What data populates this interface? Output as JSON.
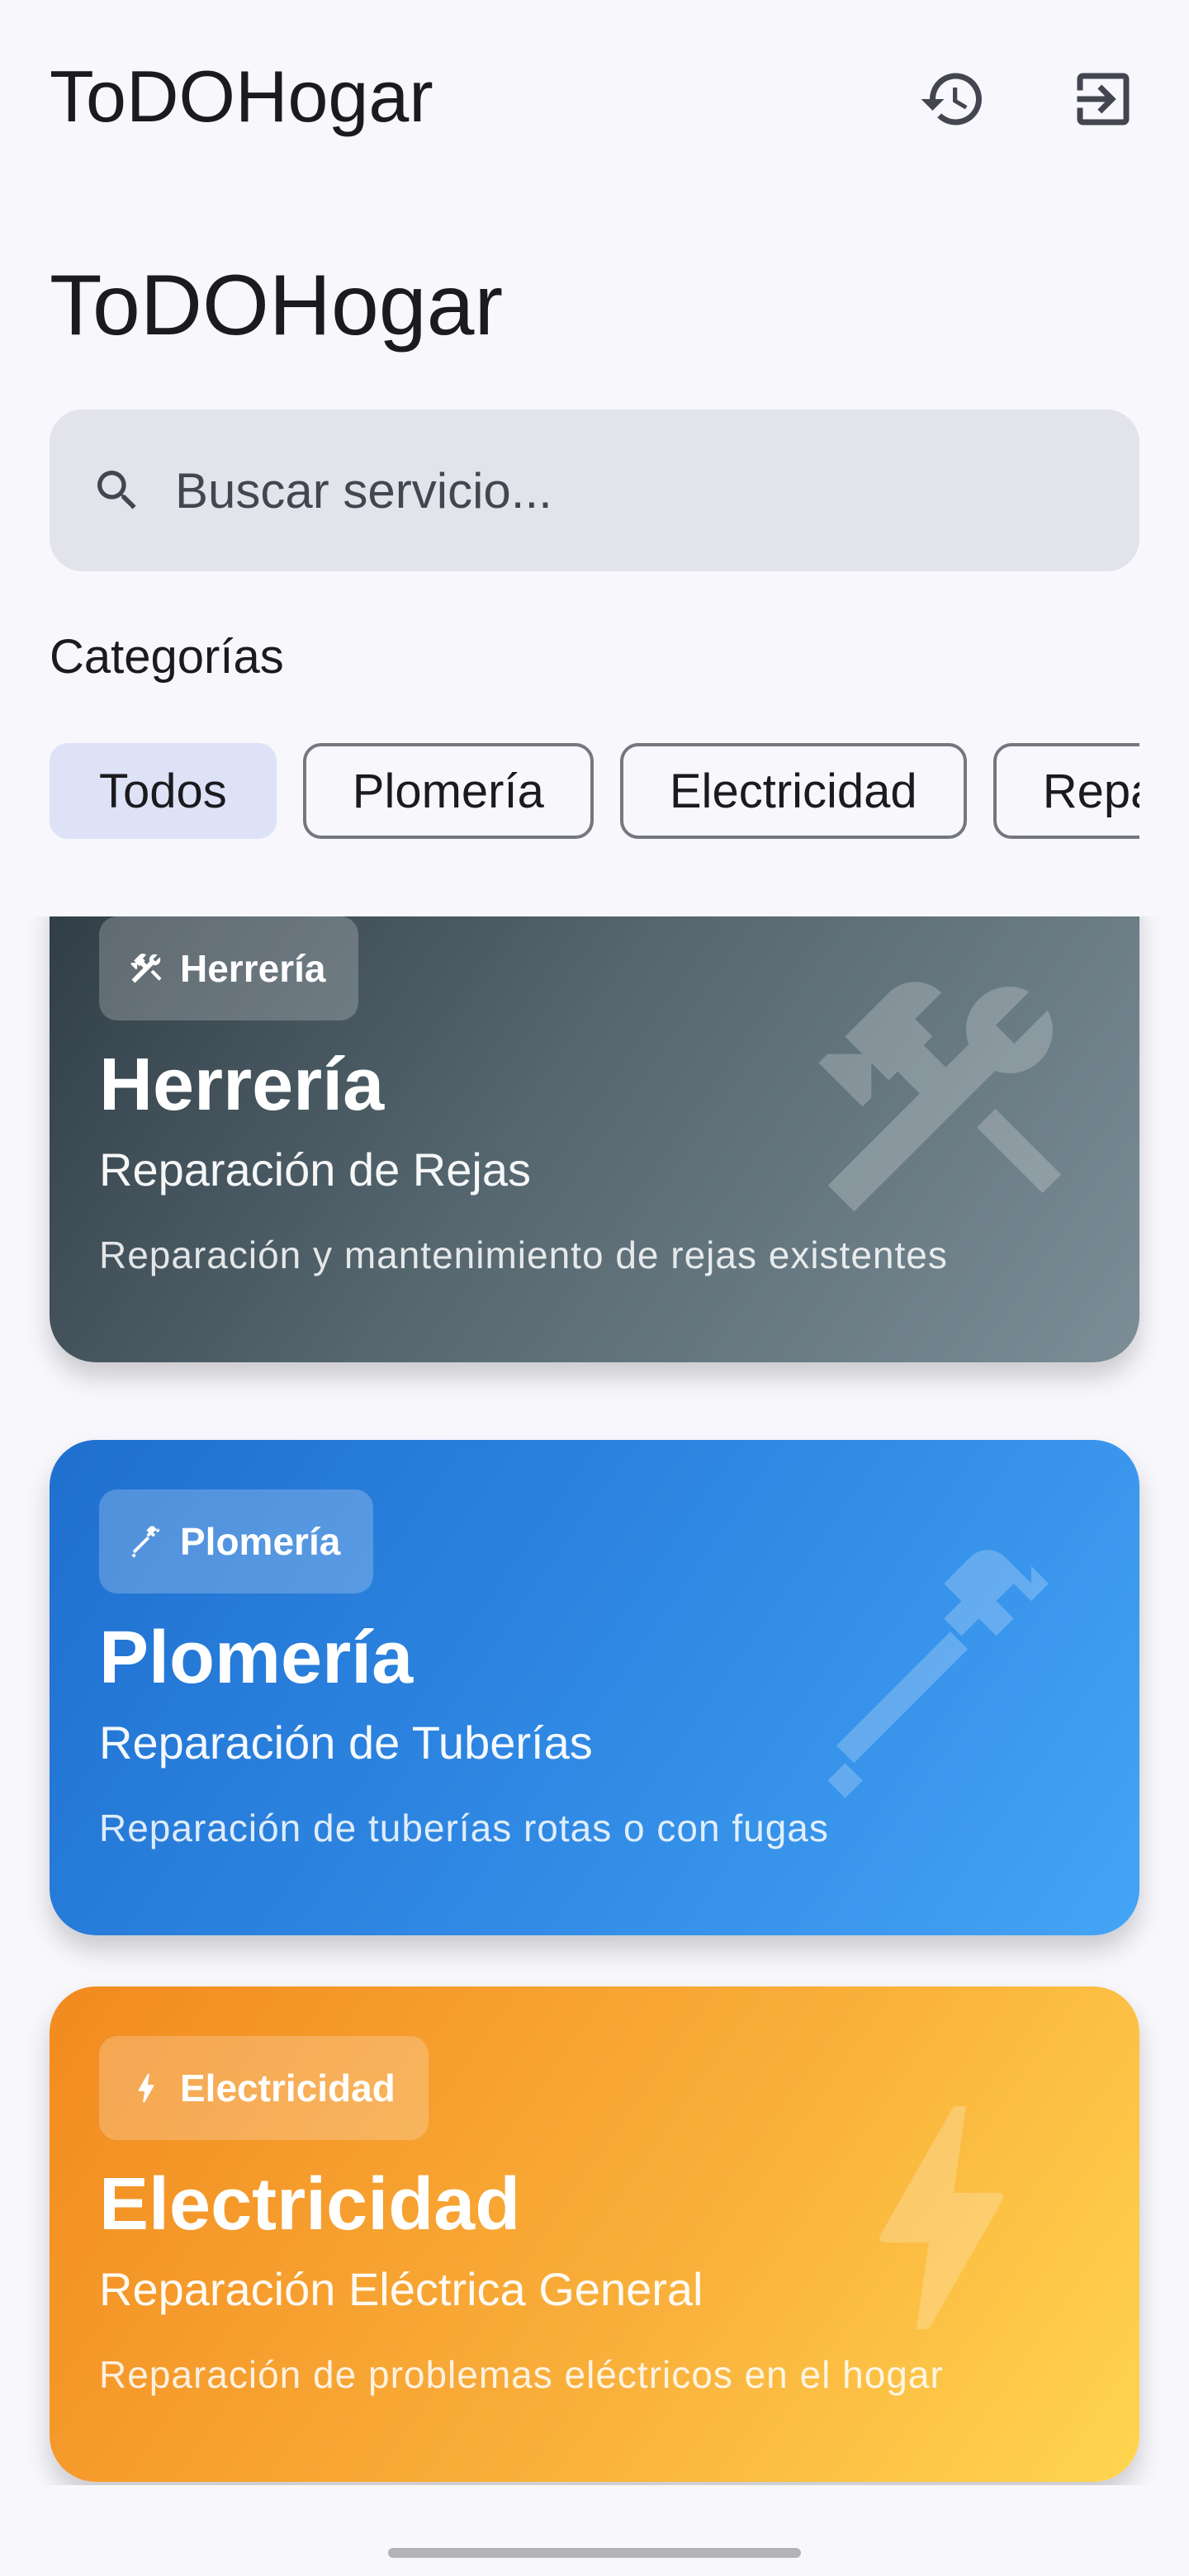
{
  "appbar": {
    "title": "ToDOHogar",
    "actions": [
      {
        "icon": "history-icon"
      },
      {
        "icon": "logout-icon"
      }
    ]
  },
  "page_title": "ToDOHogar",
  "search": {
    "placeholder": "Buscar servicio...",
    "value": ""
  },
  "categories": {
    "label": "Categorías",
    "chips": [
      "Todos",
      "Plomería",
      "Electricidad",
      "Reparaciones"
    ],
    "selected": "Todos"
  },
  "services": [
    {
      "badge": "Herrería",
      "badge_icon": "tools-icon",
      "title": "Herrería",
      "subtitle": "Reparación de Rejas",
      "description": "Reparación y mantenimiento de rejas existentes",
      "gradient": [
        "#2f3c45",
        "#7b8d96"
      ]
    },
    {
      "badge": "Plomería",
      "badge_icon": "plumbing-icon",
      "title": "Plomería",
      "subtitle": "Reparación de Tuberías",
      "description": "Reparación de tuberías rotas o con fugas",
      "gradient": [
        "#1f6fcf",
        "#44a4f5"
      ]
    },
    {
      "badge": "Electricidad",
      "badge_icon": "bolt-icon",
      "title": "Electricidad",
      "subtitle": "Reparación Eléctrica General",
      "description": "Reparación de problemas eléctricos en el hogar",
      "gradient": [
        "#f28a1f",
        "#ffd54f"
      ]
    }
  ]
}
